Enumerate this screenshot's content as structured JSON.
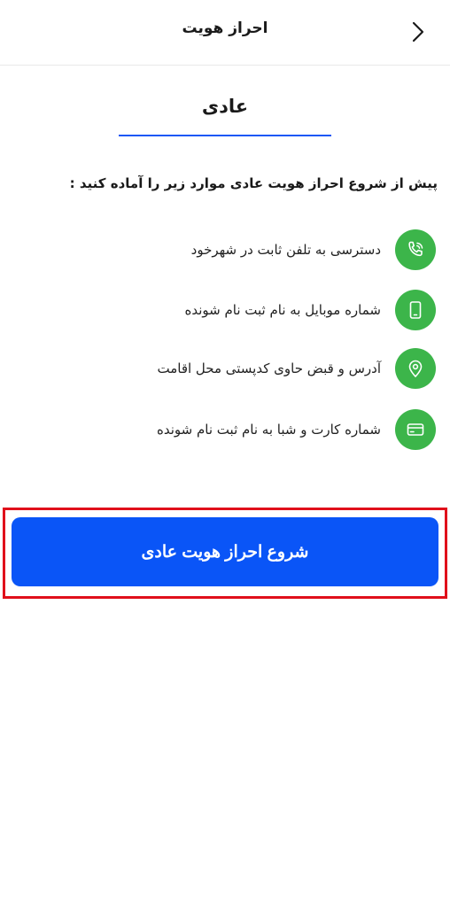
{
  "header": {
    "title": "احراز هویت",
    "back_icon": "chevron-right-icon"
  },
  "tabs": [
    {
      "label": "عادی",
      "selected": true
    }
  ],
  "intro_text": "پیش از شروع احراز هویت عادی موارد زیر را آماده کنید :",
  "requirements": [
    {
      "label": "دسترسی به تلفن ثابت در شهرخود",
      "icon": "phone-icon"
    },
    {
      "label": "شماره موبایل به نام ثبت نام شونده",
      "icon": "mobile-icon"
    },
    {
      "label": "آدرس و قبض حاوی کدپستی محل اقامت",
      "icon": "location-pin-icon"
    },
    {
      "label": "شماره کارت و شبا به نام ثبت نام شونده",
      "icon": "credit-card-icon"
    }
  ],
  "start_button": {
    "label": "شروع احراز هویت عادی"
  },
  "colors": {
    "accent": "#0a55f7",
    "tab_underline": "#1b57f5",
    "icon_bg": "#3cb54a",
    "highlight": "#e0101b"
  }
}
